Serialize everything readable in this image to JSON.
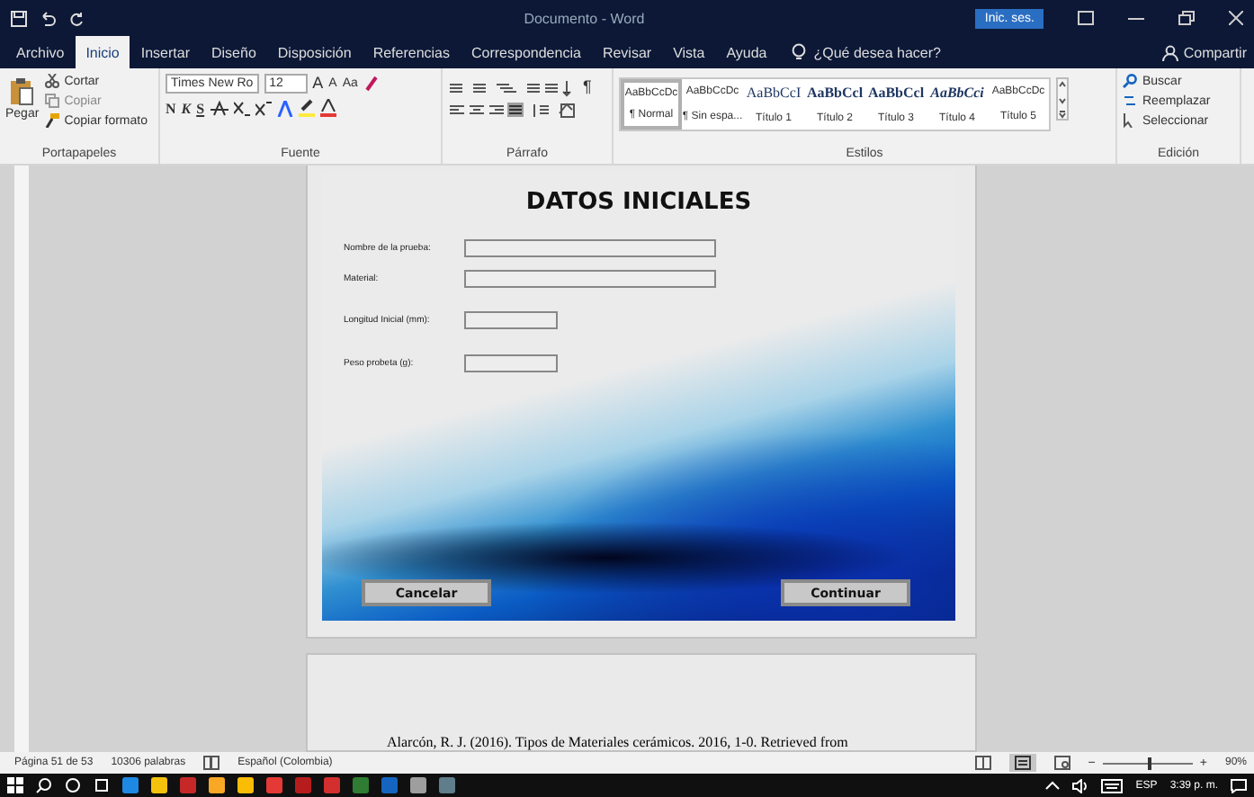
{
  "window": {
    "title": "Documento - Word",
    "sign_in": "Inic. ses."
  },
  "tabs": [
    {
      "label": "Archivo",
      "selected": false
    },
    {
      "label": "Inicio",
      "selected": true
    },
    {
      "label": "Insertar",
      "selected": false
    },
    {
      "label": "Diseño",
      "selected": false
    },
    {
      "label": "Disposición",
      "selected": false
    },
    {
      "label": "Referencias",
      "selected": false
    },
    {
      "label": "Correspondencia",
      "selected": false
    },
    {
      "label": "Revisar",
      "selected": false
    },
    {
      "label": "Vista",
      "selected": false
    },
    {
      "label": "Ayuda",
      "selected": false
    }
  ],
  "tell_me": "¿Qué desea hacer?",
  "share": "Compartir",
  "clipboard": {
    "paste": "Pegar",
    "cut": "Cortar",
    "copy": "Copiar",
    "format_painter": "Copiar formato",
    "group": "Portapapeles"
  },
  "font": {
    "name": "Times New Ro",
    "size": "12",
    "grow": "A",
    "shrink": "A",
    "case": "Aa",
    "bold": "N",
    "italic": "K",
    "underline": "S",
    "group": "Fuente"
  },
  "paragraph": {
    "marks": "¶",
    "group": "Párrafo"
  },
  "styles": {
    "items": [
      {
        "sample": "AaBbCcDc",
        "label": "¶ Normal",
        "selected": true
      },
      {
        "sample": "AaBbCcDc",
        "label": "¶ Sin espa...",
        "selected": false
      },
      {
        "sample": "AaBbCcI",
        "label": "Título 1",
        "selected": false
      },
      {
        "sample": "AaBbCcl",
        "label": "Título 2",
        "selected": false
      },
      {
        "sample": "AaBbCcl",
        "label": "Título 3",
        "selected": false
      },
      {
        "sample": "AaBbCci",
        "label": "Título 4",
        "selected": false
      },
      {
        "sample": "AaBbCcDc",
        "label": "Título 5",
        "selected": false
      }
    ],
    "group": "Estilos"
  },
  "editing": {
    "find": "Buscar",
    "replace": "Reemplazar",
    "select": "Seleccionar",
    "group": "Edición"
  },
  "dialog": {
    "title": "DATOS INICIALES",
    "fields": [
      {
        "label": "Nombre de la prueba:",
        "kind": "long"
      },
      {
        "label": "Material:",
        "kind": "long"
      },
      {
        "label": "Longitud Inicial (mm):",
        "kind": "short"
      },
      {
        "label": "Peso probeta (g):",
        "kind": "short"
      }
    ],
    "buttons": [
      "Cancelar",
      "Continuar"
    ]
  },
  "citation": "Alarcón, R. J. (2016). Tipos de Materiales cerámicos. 2016, 1-0. Retrieved from",
  "status_bar": {
    "page": "Página 51 de 53",
    "words": "10306 palabras",
    "language": "Español (Colombia)",
    "zoom": {
      "out": "−",
      "in": "+",
      "level": 0.5,
      "reading": "90%"
    }
  },
  "taskbar": {
    "language": "ESP",
    "time": "3:39 p. m."
  }
}
